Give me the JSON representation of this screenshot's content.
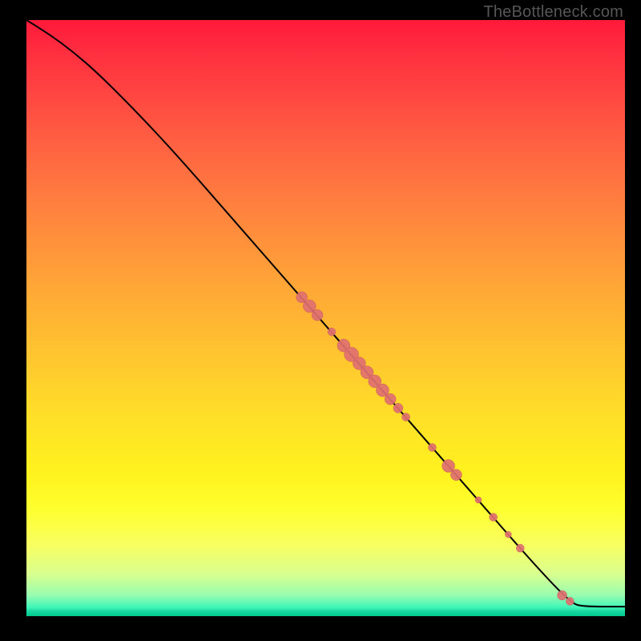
{
  "watermark": "TheBottleneck.com",
  "colors": {
    "curve": "#000000",
    "dot_fill": "#e07070",
    "dot_stroke": "#c85858"
  },
  "chart_data": {
    "type": "line",
    "title": "",
    "xlabel": "",
    "ylabel": "",
    "xlim": [
      0,
      100
    ],
    "ylim": [
      0,
      100
    ],
    "curve": [
      {
        "x": 0,
        "y": 100
      },
      {
        "x": 4,
        "y": 97.5
      },
      {
        "x": 8,
        "y": 94.5
      },
      {
        "x": 12,
        "y": 91
      },
      {
        "x": 18,
        "y": 85
      },
      {
        "x": 25,
        "y": 77.5
      },
      {
        "x": 35,
        "y": 66
      },
      {
        "x": 45,
        "y": 54.5
      },
      {
        "x": 55,
        "y": 43
      },
      {
        "x": 65,
        "y": 31.5
      },
      {
        "x": 75,
        "y": 20
      },
      {
        "x": 85,
        "y": 8.5
      },
      {
        "x": 91,
        "y": 2.2
      },
      {
        "x": 93,
        "y": 1.6
      },
      {
        "x": 100,
        "y": 1.6
      }
    ],
    "dots": [
      {
        "x": 46.0,
        "y": 53.5,
        "r": 7
      },
      {
        "x": 47.3,
        "y": 52.0,
        "r": 8
      },
      {
        "x": 48.6,
        "y": 50.5,
        "r": 7
      },
      {
        "x": 51.0,
        "y": 47.7,
        "r": 5
      },
      {
        "x": 53.0,
        "y": 45.4,
        "r": 8
      },
      {
        "x": 54.3,
        "y": 43.9,
        "r": 9
      },
      {
        "x": 55.6,
        "y": 42.4,
        "r": 8
      },
      {
        "x": 56.9,
        "y": 40.9,
        "r": 8
      },
      {
        "x": 58.2,
        "y": 39.4,
        "r": 8
      },
      {
        "x": 59.5,
        "y": 37.9,
        "r": 8
      },
      {
        "x": 60.8,
        "y": 36.4,
        "r": 7
      },
      {
        "x": 62.1,
        "y": 34.9,
        "r": 6
      },
      {
        "x": 63.4,
        "y": 33.4,
        "r": 5
      },
      {
        "x": 67.8,
        "y": 28.3,
        "r": 5
      },
      {
        "x": 70.5,
        "y": 25.2,
        "r": 8
      },
      {
        "x": 71.8,
        "y": 23.7,
        "r": 7
      },
      {
        "x": 75.5,
        "y": 19.5,
        "r": 4
      },
      {
        "x": 78.0,
        "y": 16.6,
        "r": 5
      },
      {
        "x": 80.5,
        "y": 13.7,
        "r": 4
      },
      {
        "x": 82.5,
        "y": 11.4,
        "r": 5
      },
      {
        "x": 89.5,
        "y": 3.5,
        "r": 6
      },
      {
        "x": 90.8,
        "y": 2.5,
        "r": 5
      }
    ]
  }
}
